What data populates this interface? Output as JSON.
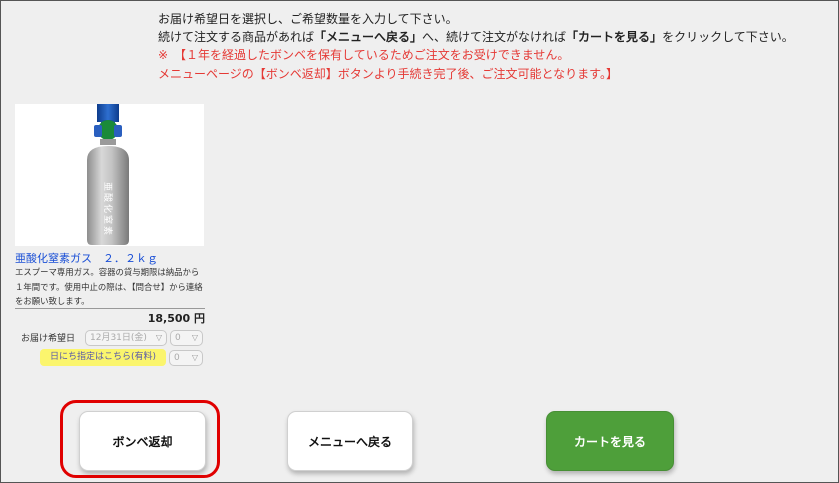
{
  "instructions": {
    "line1": "お届け希望日を選択し、ご希望数量を入力して下さい。",
    "line2_pre": "続けて注文する商品があれば",
    "line2_menu": "「メニューへ戻る」",
    "line2_mid": "へ、続けて注文がなければ",
    "line2_cart": "「カートを見る」",
    "line2_post": "をクリックして下さい。",
    "warning_line1": "※　【１年を経過したボンベを保有しているためご注文をお受けできません。",
    "warning_line2": "メニューページの【ボンベ返却】ボタンより手続き完了後、ご注文可能となります。】"
  },
  "product": {
    "name": "亜酸化窒素ガス　２．２ｋｇ",
    "description": "エスプーマ専用ガス。容器の貸与期限は納品から１年間です。使用中止の際は、【問合せ】から連絡をお願い致します。",
    "price": "18,500 円",
    "cylinder_label": "亜酸化窒素",
    "delivery_label": "お届け希望日",
    "date_select_value": "12月31日(金)",
    "qty_value": "0",
    "qty2_value": "0",
    "day_link_label": "日にち指定はこちら(有料)"
  },
  "buttons": {
    "return_cylinder": "ボンベ返却",
    "back_to_menu": "メニューへ戻る",
    "view_cart": "カートを見る"
  },
  "colors": {
    "accent_green": "#4e9f3a",
    "warning_red": "#e53935",
    "link_blue": "#1a4fd6",
    "highlight_yellow": "#fbf56d",
    "annotation_red": "#e00000"
  }
}
